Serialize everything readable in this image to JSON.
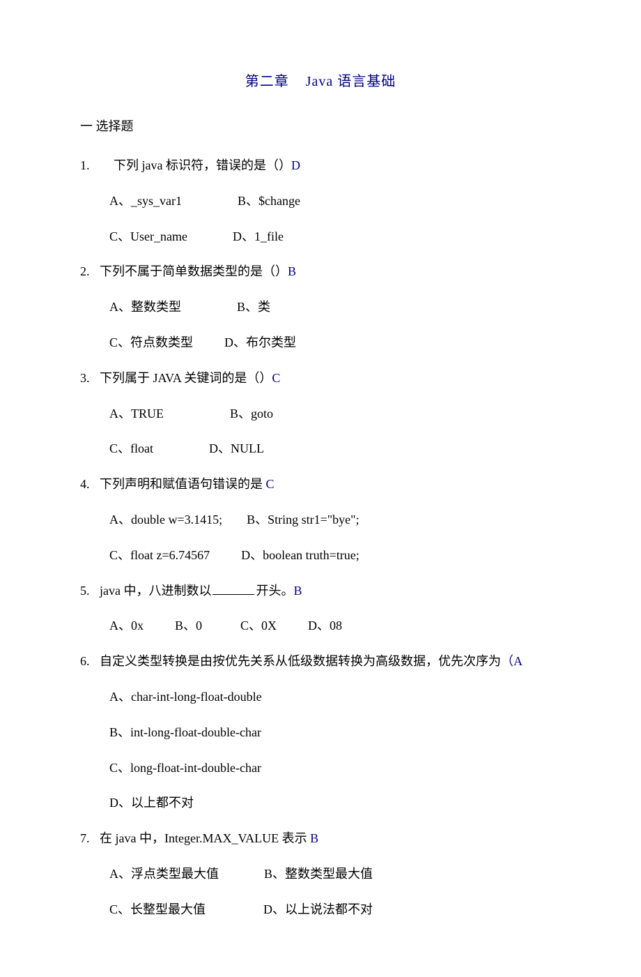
{
  "title": "第二章    Java 语言基础",
  "section_header": "一 选择题",
  "questions": [
    {
      "num": "1.",
      "indent": "wide",
      "text": "下列 java 标识符，错误的是（）",
      "answer": "D",
      "option_rows": [
        [
          {
            "text": "A、_sys_var1",
            "gap_after": 70
          },
          {
            "text": "B、$change",
            "gap_after": 0
          }
        ],
        [
          {
            "text": "C、User_name",
            "gap_after": 55
          },
          {
            "text": "D、1_file",
            "gap_after": 0
          }
        ]
      ]
    },
    {
      "num": "2.",
      "text": "下列不属于简单数据类型的是（）",
      "answer": "B",
      "option_rows": [
        [
          {
            "text": "A、整数类型",
            "gap_after": 70
          },
          {
            "text": "B、类",
            "gap_after": 0
          }
        ],
        [
          {
            "text": "C、符点数类型",
            "gap_after": 35
          },
          {
            "text": "D、布尔类型",
            "gap_after": 0
          }
        ]
      ]
    },
    {
      "num": "3.",
      "text": "下列属于 JAVA 关键词的是（）",
      "answer": "C",
      "option_rows": [
        [
          {
            "text": "A、TRUE",
            "gap_after": 85
          },
          {
            "text": "B、goto",
            "gap_after": 0
          }
        ],
        [
          {
            "text": "C、float",
            "gap_after": 70
          },
          {
            "text": "D、NULL",
            "gap_after": 0
          }
        ]
      ]
    },
    {
      "num": "4.",
      "text": "下列声明和赋值语句错误的是 ",
      "answer": "C",
      "option_rows": [
        [
          {
            "text": "A、double w=3.1415;",
            "gap_after": 25
          },
          {
            "text": "B、String str1=\"bye\";",
            "gap_after": 0
          }
        ],
        [
          {
            "text": "C、float z=6.74567",
            "gap_after": 35
          },
          {
            "text": "D、boolean truth=true;",
            "gap_after": 0
          }
        ]
      ]
    },
    {
      "num": "5.",
      "text_before_blank": "java 中，八进制数以",
      "text_after_blank": "开头。",
      "has_blank": true,
      "answer": "B",
      "option_rows": [
        [
          {
            "text": "A、0x",
            "gap_after": 35
          },
          {
            "text": "B、0",
            "gap_after": 45
          },
          {
            "text": "C、0X",
            "gap_after": 35
          },
          {
            "text": "D、08",
            "gap_after": 0
          }
        ]
      ]
    },
    {
      "num": "6.",
      "text": "自定义类型转换是由按优先关系从低级数据转换为高级数据，优先次序为",
      "answer_prefix": "（",
      "answer": "A",
      "option_rows": [
        [
          {
            "text": "A、char-int-long-float-double",
            "gap_after": 0
          }
        ],
        [
          {
            "text": "B、int-long-float-double-char",
            "gap_after": 0
          }
        ],
        [
          {
            "text": "C、long-float-int-double-char",
            "gap_after": 0
          }
        ],
        [
          {
            "text": "D、以上都不对",
            "gap_after": 0
          }
        ]
      ]
    },
    {
      "num": "7.",
      "text": "在 java 中，Integer.MAX_VALUE 表示 ",
      "answer": "B",
      "option_rows": [
        [
          {
            "text": "A、浮点类型最大值",
            "gap_after": 55
          },
          {
            "text": "B、整数类型最大值",
            "gap_after": 0
          }
        ],
        [
          {
            "text": "C、长整型最大值",
            "gap_after": 73
          },
          {
            "text": "D、以上说法都不对",
            "gap_after": 0
          }
        ]
      ]
    }
  ]
}
